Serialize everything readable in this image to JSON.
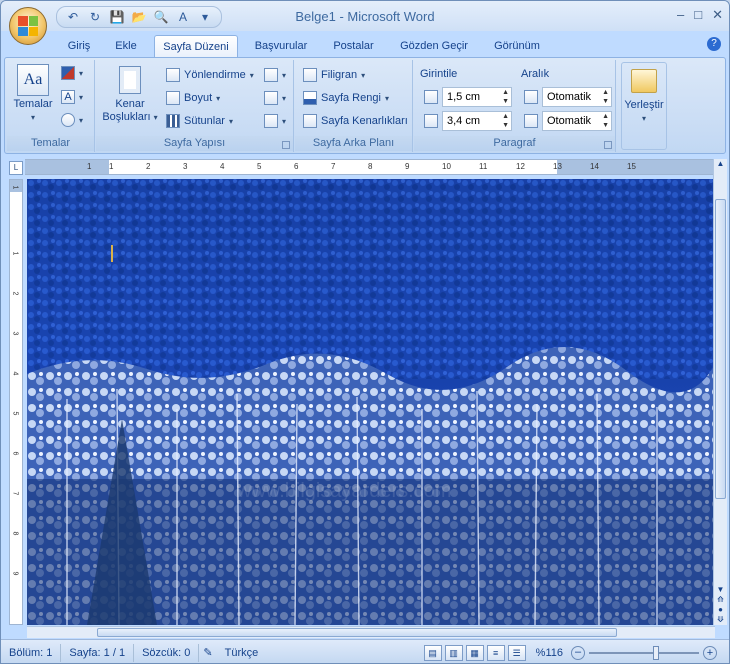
{
  "window": {
    "title": "Belge1 - Microsoft Word",
    "controls": [
      "–",
      "□",
      "✕"
    ]
  },
  "qat": {
    "icons": [
      "undo-icon",
      "redo-icon",
      "save-icon",
      "open-icon",
      "print-preview-icon",
      "spelling-icon",
      "customize-icon"
    ],
    "glyphs": [
      "↶",
      "↻",
      "💾",
      "📂",
      "🔍",
      "A",
      "▾"
    ]
  },
  "tabs": [
    "Giriş",
    "Ekle",
    "Sayfa Düzeni",
    "Başvurular",
    "Postalar",
    "Gözden Geçir",
    "Görünüm"
  ],
  "active_tab": "Sayfa Düzeni",
  "ribbon": {
    "temalar": {
      "big_label": "Temalar",
      "group_label": "Temalar"
    },
    "sayfa_yapisi": {
      "kenar": "Kenar",
      "bosluklari": "Boşlukları",
      "yonlendirme": "Yönlendirme",
      "boyut": "Boyut",
      "sutunlar": "Sütunlar",
      "group_label": "Sayfa Yapısı"
    },
    "arka_plan": {
      "filigran": "Filigran",
      "sayfa_rengi": "Sayfa Rengi",
      "kenarliklar": "Sayfa Kenarlıkları",
      "group_label": "Sayfa Arka Planı"
    },
    "paragraf": {
      "girintile": "Girintile",
      "aralik": "Aralık",
      "indent_left": "1,5 cm",
      "indent_right": "3,4 cm",
      "space_before": "Otomatik",
      "space_after": "Otomatik",
      "group_label": "Paragraf"
    },
    "yerlestir": {
      "label": "Yerleştir"
    }
  },
  "ruler": {
    "h_numbers": [
      "1",
      "1",
      "2",
      "3",
      "4",
      "5",
      "6",
      "7",
      "8",
      "9",
      "10",
      "11",
      "12",
      "13",
      "14",
      "15"
    ],
    "v_numbers": [
      "1",
      "1",
      "2",
      "3",
      "4",
      "5",
      "6",
      "7",
      "8",
      "9"
    ]
  },
  "watermark_text": "www.bilgisayarders.com",
  "status": {
    "bolum": "Bölüm: 1",
    "sayfa": "Sayfa: 1 / 1",
    "sozcuk": "Sözcük: 0",
    "dil": "Türkçe",
    "zoom": "%116"
  }
}
